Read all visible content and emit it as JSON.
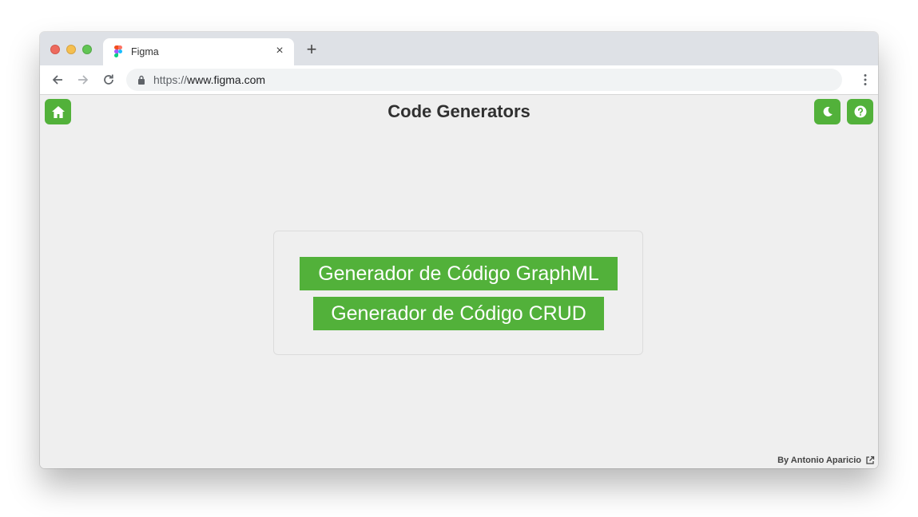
{
  "browser": {
    "tab": {
      "title": "Figma",
      "favicon": "figma-logo-icon",
      "close_icon": "close-icon"
    },
    "new_tab_icon": "plus-icon",
    "nav": {
      "back_icon": "arrow-left-icon",
      "forward_icon": "arrow-right-icon",
      "reload_icon": "reload-icon"
    },
    "address_bar": {
      "scheme": "https://",
      "host": "www.figma.com",
      "lock_icon": "lock-icon"
    },
    "menu_icon": "more-vertical-icon"
  },
  "app": {
    "title": "Code Generators",
    "home_icon": "home-icon",
    "theme_icon": "moon-icon",
    "help_icon": "help-circle-icon",
    "buttons": {
      "graphml": "Generador de Código GraphML",
      "crud": "Generador de Código CRUD"
    },
    "footer": {
      "credit": "By Antonio Aparicio",
      "link_icon": "external-link-icon"
    }
  },
  "colors": {
    "accent": "#52b13a",
    "background": "#efefef",
    "title": "#303030"
  }
}
